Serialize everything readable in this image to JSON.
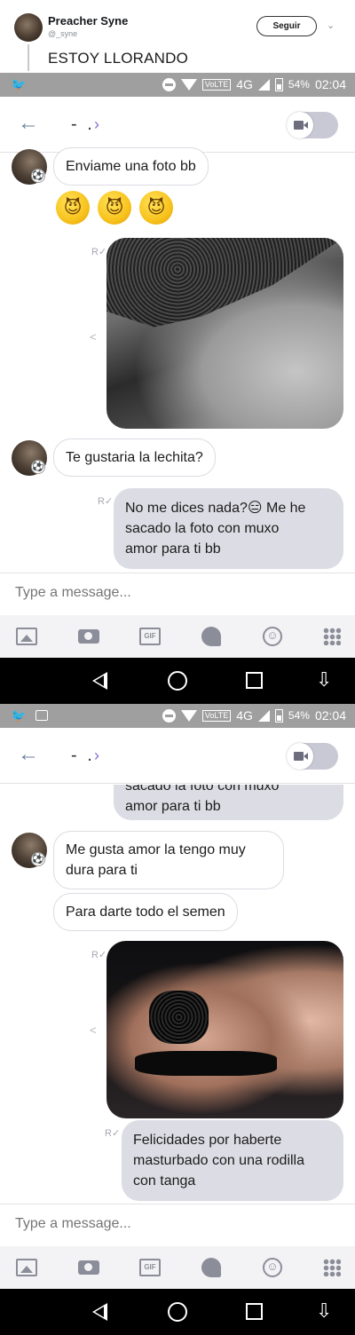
{
  "tweet": {
    "user_name": "Preacher Syne",
    "handle": "@_syne",
    "follow_label": "Seguir",
    "caret": "⌄",
    "text": "ESTOY LLORANDO"
  },
  "status_bar": {
    "volte": "VoLTE",
    "network": "4G",
    "battery": "54%",
    "time": "02:04"
  },
  "chat_header": {
    "back": "←",
    "contact_name": "- .",
    "chevron": "›"
  },
  "screen1": {
    "messages": [
      {
        "from": "them",
        "text": "Enviame una foto bb"
      },
      {
        "from": "them",
        "emojis": [
          "😈",
          "😈",
          "😈"
        ]
      },
      {
        "from": "me",
        "type": "photo"
      },
      {
        "from": "them",
        "text": "Te gustaria la lechita?"
      },
      {
        "from": "me",
        "lines": [
          "No me dices nada?😑 Me he",
          "sacado la foto con muxo",
          "amor para ti bb"
        ]
      }
    ]
  },
  "screen2": {
    "partial_lines": [
      "sacado la foto con muxo",
      "amor para ti bb"
    ],
    "messages": [
      {
        "from": "them",
        "lines": [
          "Me gusta amor la tengo muy",
          "dura para ti"
        ]
      },
      {
        "from": "them",
        "text": "Para darte todo el semen"
      },
      {
        "from": "me",
        "type": "photo"
      },
      {
        "from": "me",
        "lines": [
          "Felicidades por haberte",
          "masturbado con una rodilla",
          "con tanga"
        ]
      }
    ]
  },
  "composer": {
    "placeholder": "Type a message..."
  },
  "toolbar": {
    "gif_label": "GIF",
    "emoji_face": "☺"
  },
  "navbar": {
    "down_arrow": "⇩"
  },
  "icons": {
    "read_receipt": "R✓",
    "share": "<",
    "twitter": "🐦",
    "avatar_badge": "⚽"
  },
  "colors": {
    "status_bar": "#9f9f9f",
    "outgoing_bubble": "#dcdce4",
    "accent": "#8a6fd0"
  }
}
